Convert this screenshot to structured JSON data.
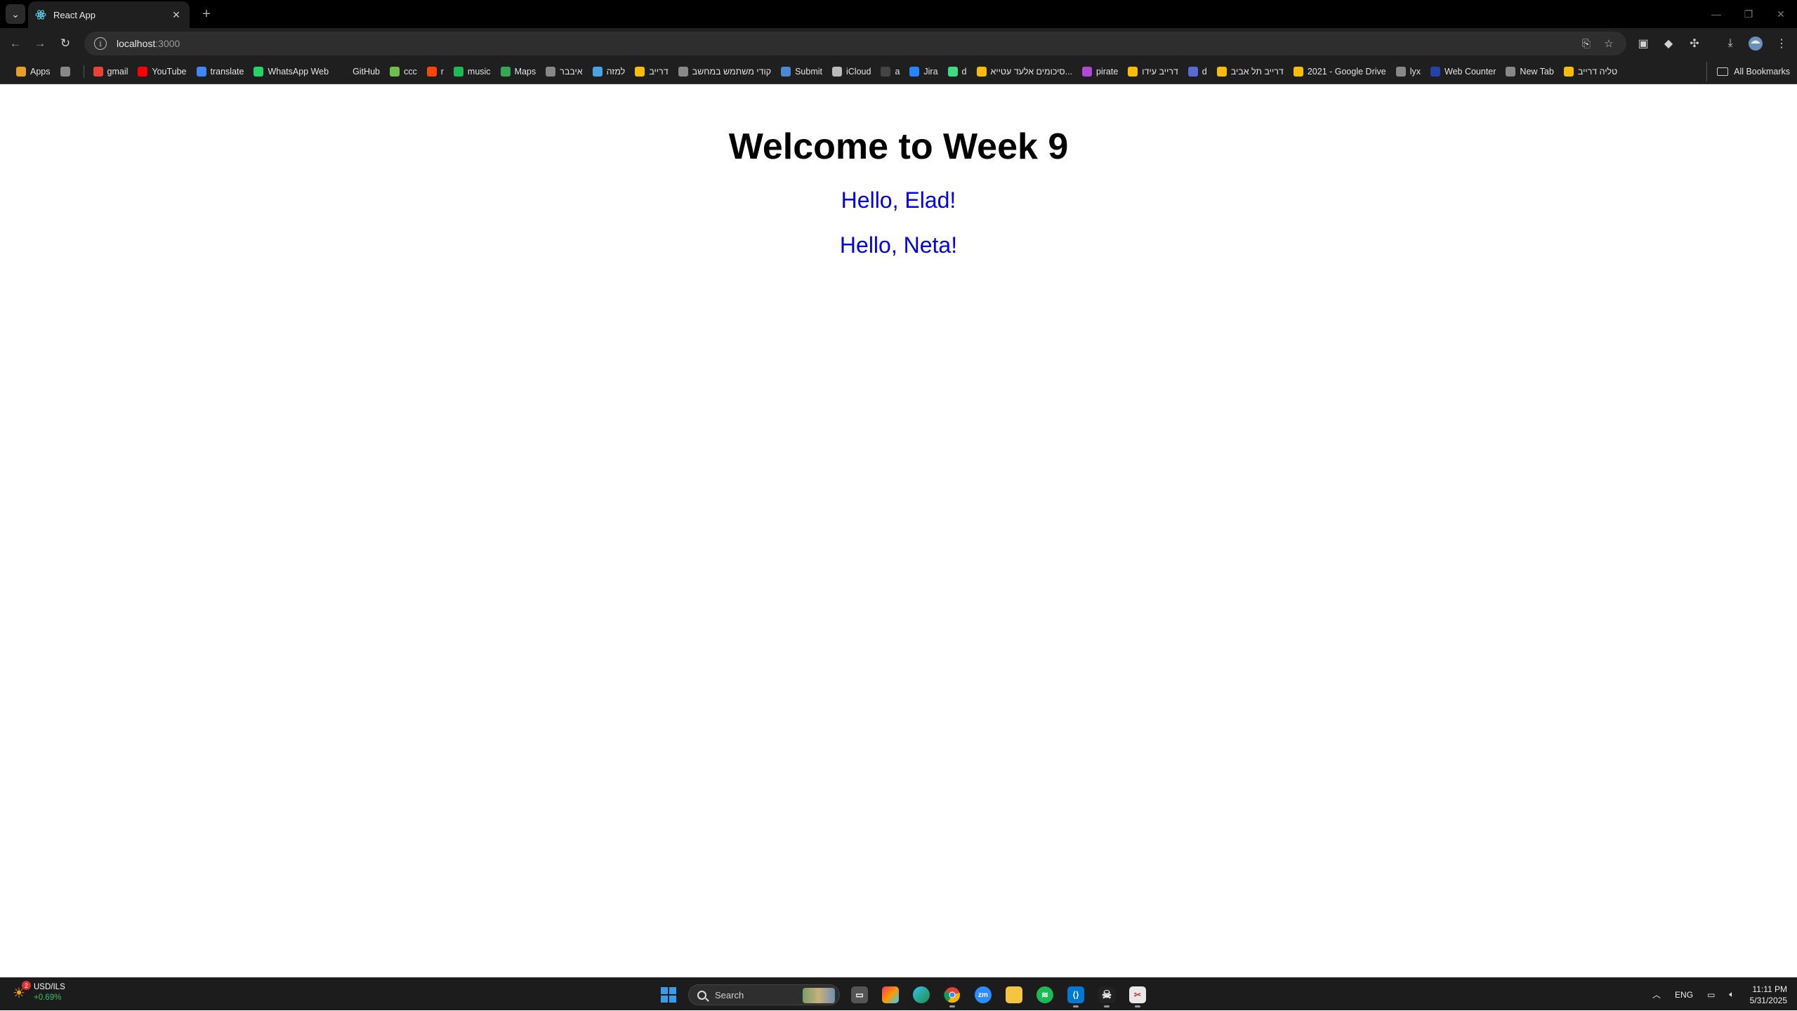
{
  "browser": {
    "tab": {
      "title": "React App"
    },
    "address": {
      "host": "localhost",
      "port": ":3000"
    },
    "bookmarks": [
      {
        "label": "Apps",
        "icon": "apps-grid-icon",
        "color": "#e8a020"
      },
      {
        "label": "",
        "icon": "tab-groups-icon",
        "color": "#888888"
      },
      {
        "label": "gmail",
        "icon": "gmail-icon",
        "color": "#ea4335"
      },
      {
        "label": "YouTube",
        "icon": "youtube-icon",
        "color": "#ff0000"
      },
      {
        "label": "translate",
        "icon": "google-icon",
        "color": "#4285f4"
      },
      {
        "label": "WhatsApp Web",
        "icon": "whatsapp-icon",
        "color": "#25d366"
      },
      {
        "label": "GitHub",
        "icon": "github-icon",
        "color": "#1f1f1f"
      },
      {
        "label": "ccc",
        "icon": "person-icon",
        "color": "#6fbf4a"
      },
      {
        "label": "r",
        "icon": "reddit-icon",
        "color": "#ff4500"
      },
      {
        "label": "music",
        "icon": "spotify-icon",
        "color": "#1db954"
      },
      {
        "label": "Maps",
        "icon": "maps-icon",
        "color": "#34a853"
      },
      {
        "label": "איבבר",
        "icon": "globe-icon",
        "color": "#888888"
      },
      {
        "label": "למזה",
        "icon": "wave-icon",
        "color": "#4aa3df"
      },
      {
        "label": "דרייב",
        "icon": "drive-icon",
        "color": "#fbbc04"
      },
      {
        "label": "קודי משתמש במחשב",
        "icon": "globe-icon",
        "color": "#888888"
      },
      {
        "label": "Submit",
        "icon": "upload-icon",
        "color": "#4a8ad4"
      },
      {
        "label": "iCloud",
        "icon": "apple-icon",
        "color": "#bbbbbb"
      },
      {
        "label": "a",
        "icon": "circle-icon",
        "color": "#444444"
      },
      {
        "label": "Jira",
        "icon": "jira-icon",
        "color": "#2684ff"
      },
      {
        "label": "d",
        "icon": "android-icon",
        "color": "#3ddc84"
      },
      {
        "label": "סיכומים אלעד עטייא...",
        "icon": "drive-icon",
        "color": "#fbbc04"
      },
      {
        "label": "pirate",
        "icon": "pirate-icon",
        "color": "#b04ad4"
      },
      {
        "label": "דרייב עידו",
        "icon": "drive-icon",
        "color": "#fbbc04"
      },
      {
        "label": "d",
        "icon": "bars-icon",
        "color": "#5a6ad4"
      },
      {
        "label": "דרייב תל אביב",
        "icon": "drive-icon",
        "color": "#fbbc04"
      },
      {
        "label": "2021 - Google Drive",
        "icon": "drive-icon",
        "color": "#fbbc04"
      },
      {
        "label": "lyx",
        "icon": "globe-icon",
        "color": "#888888"
      },
      {
        "label": "Web Counter",
        "icon": "ipi-icon",
        "color": "#2244aa"
      },
      {
        "label": "New Tab",
        "icon": "globe-icon",
        "color": "#888888"
      },
      {
        "label": "טליה דרייב",
        "icon": "drive-icon",
        "color": "#fbbc04"
      }
    ],
    "all_bookmarks_label": "All Bookmarks"
  },
  "page": {
    "heading": "Welcome to Week 9",
    "greetings": [
      "Hello, Elad!",
      "Hello, Neta!"
    ],
    "greeting_color": "#0000ee"
  },
  "taskbar": {
    "widget": {
      "badge": "2",
      "line1": "USD/ILS",
      "line2": "+0.69%"
    },
    "search_placeholder": "Search",
    "language": "ENG",
    "time": "11:11 PM",
    "date": "5/31/2025"
  }
}
